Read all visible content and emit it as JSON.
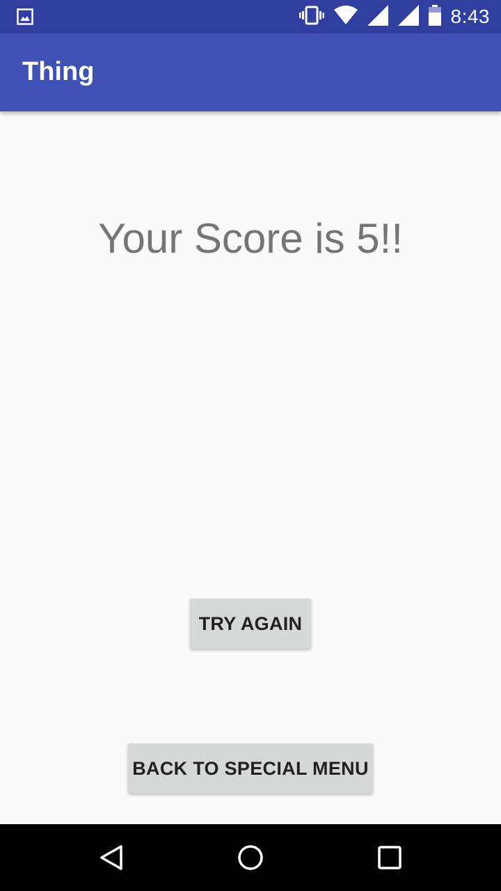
{
  "status_bar": {
    "time": "8:43",
    "icons": [
      "image-icon",
      "vibrate-icon",
      "wifi-icon",
      "signal-icon",
      "signal-icon",
      "battery-icon"
    ],
    "color": "#303f9f"
  },
  "app_bar": {
    "title": "Thing",
    "color": "#3f51b5"
  },
  "main": {
    "score_text": "Your Score is 5!!",
    "try_again_label": "TRY AGAIN",
    "back_label": "BACK TO SPECIAL MENU"
  },
  "nav_bar": {
    "icons": [
      "back-icon",
      "home-icon",
      "recents-icon"
    ]
  }
}
